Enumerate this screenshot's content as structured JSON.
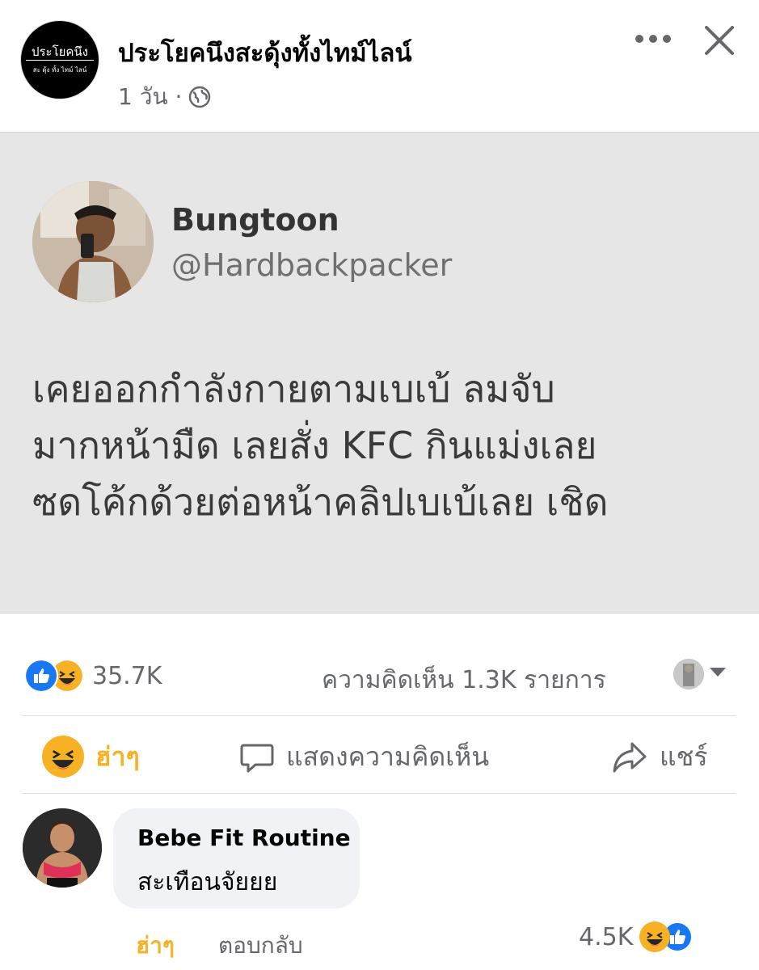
{
  "header": {
    "page_avatar_text": "ประโยคนึง",
    "page_avatar_subtext": "สะ ดุ้ง ทั้ง ไทม์ ไลน์",
    "page_name": "ประโยคนึงสะดุ้งทั้งไทม์ไลน์",
    "post_time": "1 วัน ·",
    "more_icon": "more-horizontal-icon",
    "close_icon": "close-icon",
    "privacy_icon": "globe-icon"
  },
  "tweet": {
    "name": "Bungtoon",
    "handle": "@Hardbackpacker",
    "lines": [
      "เคยออกกำลังกายตามเบเบ้ ลมจับ",
      "มากหน้ามืด เลยสั่ง KFC กินแม่งเลย",
      "ซดโค้กด้วยต่อหน้าคลิปเบเบ้เลย เชิด"
    ]
  },
  "stats": {
    "reaction_count": "35.7K",
    "comments_label": "ความคิดเห็น 1.3K รายการ"
  },
  "actions": {
    "haha_label": "ฮ่าๆ",
    "comment_label": "แสดงความคิดเห็น",
    "share_label": "แชร์"
  },
  "comment": {
    "author": "Bebe Fit Routine",
    "text": "สะเทือนจัยยย",
    "haha_label": "ฮ่าๆ",
    "reply_label": "ตอบกลับ",
    "reaction_count": "4.5K"
  },
  "colors": {
    "haha": "#f7b125",
    "like": "#1877f2",
    "muted": "#65676b"
  }
}
